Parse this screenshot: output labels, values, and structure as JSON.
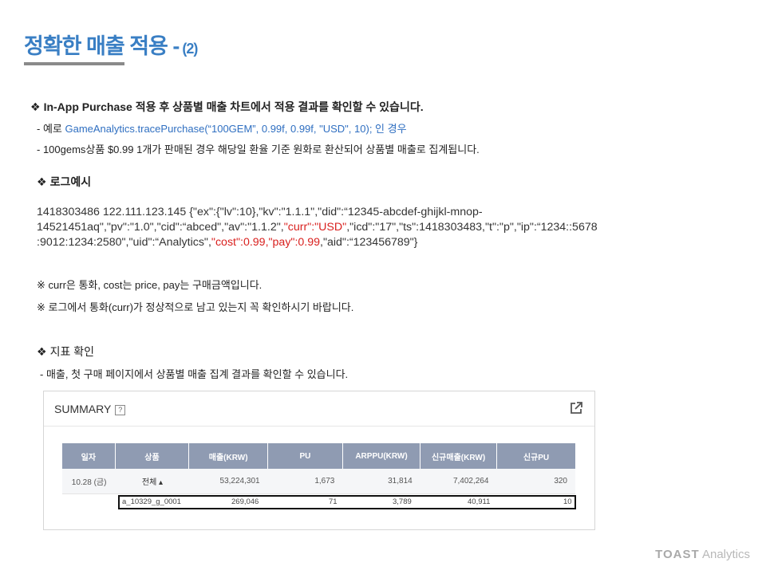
{
  "title": {
    "main": "정확한 매출 적용 -",
    "sub": "(2)"
  },
  "section1": {
    "heading": "In-App Purchase 적용 후 상품별 매출 차트에서 적용 결과를 확인할 수 있습니다.",
    "example_prefix": "- 예로 ",
    "example_code": "GameAnalytics.tracePurchase(“100GEM”, 0.99f, 0.99f, \"USD\", 10); 인 경우",
    "note": "- 100gems상품 $0.99 1개가 판매된 경우 해당일 환율 기준 원화로 환산되어 상품별 매출로 집계됩니다."
  },
  "section2": {
    "heading": "로그예시",
    "log_line1": "1418303486  122.111.123.145 {\"ex\":{\"lv\":10},\"kv\":\"1.1.1\",\"did\":“12345-abcdef-ghijkl-mnop-",
    "log_line2_a": "14521451aq\",\"pv\":\"1.0\",\"cid\":“abced\",\"av\":\"1.1.2\",",
    "log_line2_curr": "\"curr\":\"USD\"",
    "log_line2_b": ",\"icd\":\"17\",\"ts\":1418303483,\"t\":\"p\",\"ip\":“1234::5678",
    "log_line3_a": ":9012:1234:2580\",\"uid\":“Analytics\",",
    "log_line3_cost": "\"cost\":0.99,\"pay\":0.99",
    "log_line3_b": ",\"aid\":“123456789\"}",
    "note1": "※ curr은 통화, cost는 price, pay는 구매금액입니다.",
    "note2": "※ 로그에서 통화(curr)가 정상적으로 남고 있는지 꼭 확인하시기 바랍니다."
  },
  "section3": {
    "heading": "지표 확인",
    "desc": "- 매출, 첫 구매 페이지에서 상품별 매출 집계 결과를 확인할 수 있습니다."
  },
  "summary": {
    "title": "SUMMARY",
    "help": "?",
    "columns": [
      "일자",
      "상품",
      "매출(KRW)",
      "PU",
      "ARPPU(KRW)",
      "신규매출(KRW)",
      "신규PU"
    ],
    "row": {
      "date": "10.28 (금)",
      "product": "전체 ▴",
      "sales": "53,224,301",
      "pu": "1,673",
      "arppu": "31,814",
      "new_sales": "7,402,264",
      "new_pu": "320"
    },
    "sub_row": {
      "product": "a_10329_g_0001",
      "sales": "269,046",
      "pu": "71",
      "arppu": "3,789",
      "new_sales": "40,911",
      "new_pu": "10"
    }
  },
  "brand": {
    "toast": "TOAST",
    "analytics": "Analytics"
  },
  "colors": {
    "accent": "#3a7fc4",
    "highlight": "#d9201e",
    "table_header": "#8f9bb2"
  }
}
